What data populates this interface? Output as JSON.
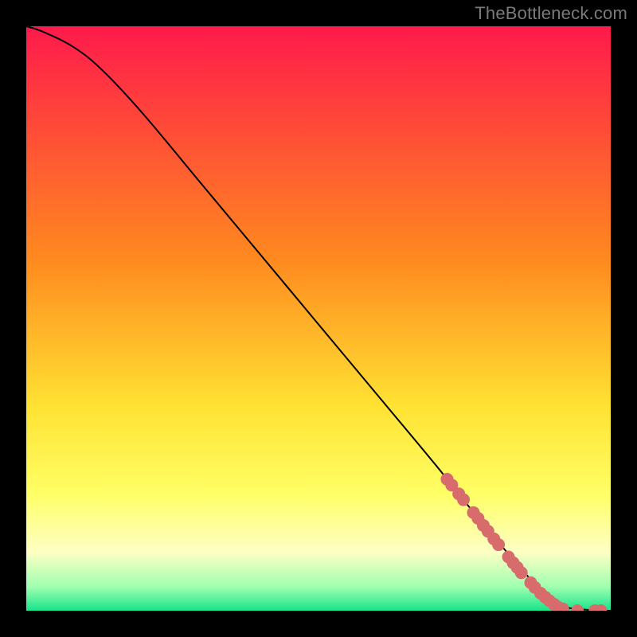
{
  "attribution": "TheBottleneck.com",
  "chart_data": {
    "type": "line",
    "title": "",
    "xlabel": "",
    "ylabel": "",
    "xlim": [
      0,
      100
    ],
    "ylim": [
      0,
      100
    ],
    "background_gradient": {
      "stops": [
        {
          "pos": 0,
          "color": "#ff1a4b"
        },
        {
          "pos": 40,
          "color": "#ff8a1f"
        },
        {
          "pos": 65,
          "color": "#ffe233"
        },
        {
          "pos": 80,
          "color": "#ffff66"
        },
        {
          "pos": 90,
          "color": "#fdffc4"
        },
        {
          "pos": 96,
          "color": "#9dffb0"
        },
        {
          "pos": 100,
          "color": "#17e38a"
        }
      ]
    },
    "curve": [
      {
        "x": 0,
        "y": 100
      },
      {
        "x": 3,
        "y": 99
      },
      {
        "x": 8,
        "y": 96.5
      },
      {
        "x": 13,
        "y": 92.5
      },
      {
        "x": 20,
        "y": 85
      },
      {
        "x": 30,
        "y": 73
      },
      {
        "x": 40,
        "y": 61
      },
      {
        "x": 50,
        "y": 49
      },
      {
        "x": 60,
        "y": 37
      },
      {
        "x": 70,
        "y": 25
      },
      {
        "x": 78,
        "y": 15
      },
      {
        "x": 84,
        "y": 8
      },
      {
        "x": 88,
        "y": 3.5
      },
      {
        "x": 91,
        "y": 1.2
      },
      {
        "x": 94,
        "y": 0.3
      },
      {
        "x": 100,
        "y": 0
      }
    ],
    "markers": [
      {
        "x": 72.0,
        "y": 22.5
      },
      {
        "x": 72.8,
        "y": 21.5
      },
      {
        "x": 74.0,
        "y": 20.0
      },
      {
        "x": 74.8,
        "y": 19.0
      },
      {
        "x": 76.5,
        "y": 16.8
      },
      {
        "x": 77.3,
        "y": 15.8
      },
      {
        "x": 78.2,
        "y": 14.6
      },
      {
        "x": 79.0,
        "y": 13.6
      },
      {
        "x": 80.0,
        "y": 12.3
      },
      {
        "x": 80.8,
        "y": 11.3
      },
      {
        "x": 82.5,
        "y": 9.2
      },
      {
        "x": 83.3,
        "y": 8.2
      },
      {
        "x": 84.0,
        "y": 7.4
      },
      {
        "x": 84.7,
        "y": 6.5
      },
      {
        "x": 86.3,
        "y": 4.8
      },
      {
        "x": 87.0,
        "y": 4.0
      },
      {
        "x": 88.0,
        "y": 3.0
      },
      {
        "x": 88.8,
        "y": 2.3
      },
      {
        "x": 89.5,
        "y": 1.7
      },
      {
        "x": 90.3,
        "y": 1.1
      },
      {
        "x": 91.0,
        "y": 0.6
      },
      {
        "x": 91.8,
        "y": 0.3
      },
      {
        "x": 94.3,
        "y": 0.0
      },
      {
        "x": 97.3,
        "y": 0.0
      },
      {
        "x": 98.3,
        "y": 0.0
      }
    ],
    "marker_style": {
      "color": "#d86b6b",
      "radius_px": 8
    }
  }
}
